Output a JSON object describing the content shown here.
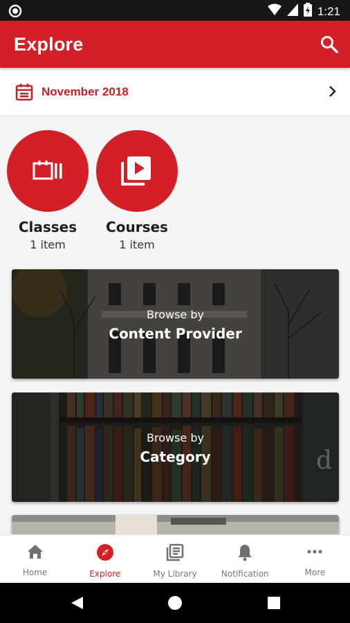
{
  "status_bar": {
    "time": "1:21"
  },
  "app_bar": {
    "title": "Explore",
    "search_icon": "search-icon"
  },
  "date_picker": {
    "label": "November 2018",
    "icon": "calendar-icon"
  },
  "shortcuts": [
    {
      "label": "Classes",
      "count": "1 item",
      "icon": "classes-icon"
    },
    {
      "label": "Courses",
      "count": "1 item",
      "icon": "video-library-icon"
    }
  ],
  "browse_cards": [
    {
      "prefix": "Browse by",
      "title": "Content Provider"
    },
    {
      "prefix": "Browse by",
      "title": "Category"
    }
  ],
  "bottom_nav": [
    {
      "label": "Home",
      "icon": "home-icon"
    },
    {
      "label": "Explore",
      "icon": "compass-icon"
    },
    {
      "label": "My Library",
      "icon": "library-icon"
    },
    {
      "label": "Notification",
      "icon": "bell-icon"
    },
    {
      "label": "More",
      "icon": "more-icon"
    }
  ],
  "colors": {
    "brand": "#d32027",
    "active_tab": "#d32027"
  }
}
